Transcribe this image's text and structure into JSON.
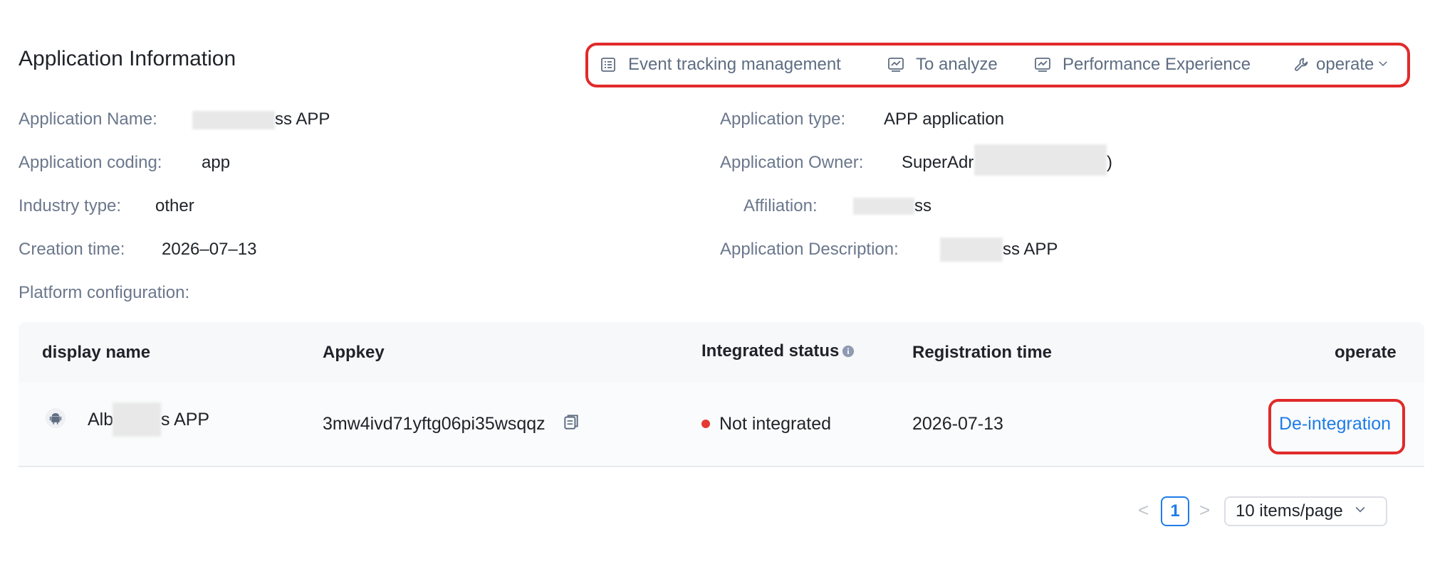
{
  "header": {
    "title": "Application Information",
    "toolbar": {
      "event_tracking": "Event tracking management",
      "analyze": "To analyze",
      "performance": "Performance Experience",
      "operate": "operate"
    }
  },
  "info": {
    "app_name_label": "Application Name:",
    "app_name_value": "ss APP",
    "app_type_label": "Application type:",
    "app_type_value": "APP application",
    "app_coding_label": "Application coding:",
    "app_coding_value": "app",
    "app_owner_label": "Application Owner:",
    "app_owner_value": "SuperAdr",
    "app_owner_suffix": ")",
    "industry_label": "Industry type:",
    "industry_value": "other",
    "affiliation_label": "Affiliation:",
    "affiliation_value": "ss",
    "creation_label": "Creation time:",
    "creation_value": "2026–07–13",
    "description_label": "Application Description:",
    "description_value": "ss APP",
    "platform_label": "Platform configuration:"
  },
  "table": {
    "headers": {
      "display_name": "display name",
      "appkey": "Appkey",
      "integrated_status": "Integrated status",
      "registration_time": "Registration time",
      "operate": "operate"
    },
    "rows": [
      {
        "name_prefix": "Alb",
        "name_suffix": "s APP",
        "appkey": "3mw4ivd71yftg06pi35wsqqz",
        "status": "Not integrated",
        "registration_time": "2026-07-13",
        "action": "De-integration"
      }
    ]
  },
  "pagination": {
    "prev": "<",
    "current_page": "1",
    "next": ">",
    "page_size": "10 items/page"
  },
  "colors": {
    "accent": "#1e7ce8",
    "status_dot": "#e53935",
    "highlight_frame": "#e12a2a"
  }
}
